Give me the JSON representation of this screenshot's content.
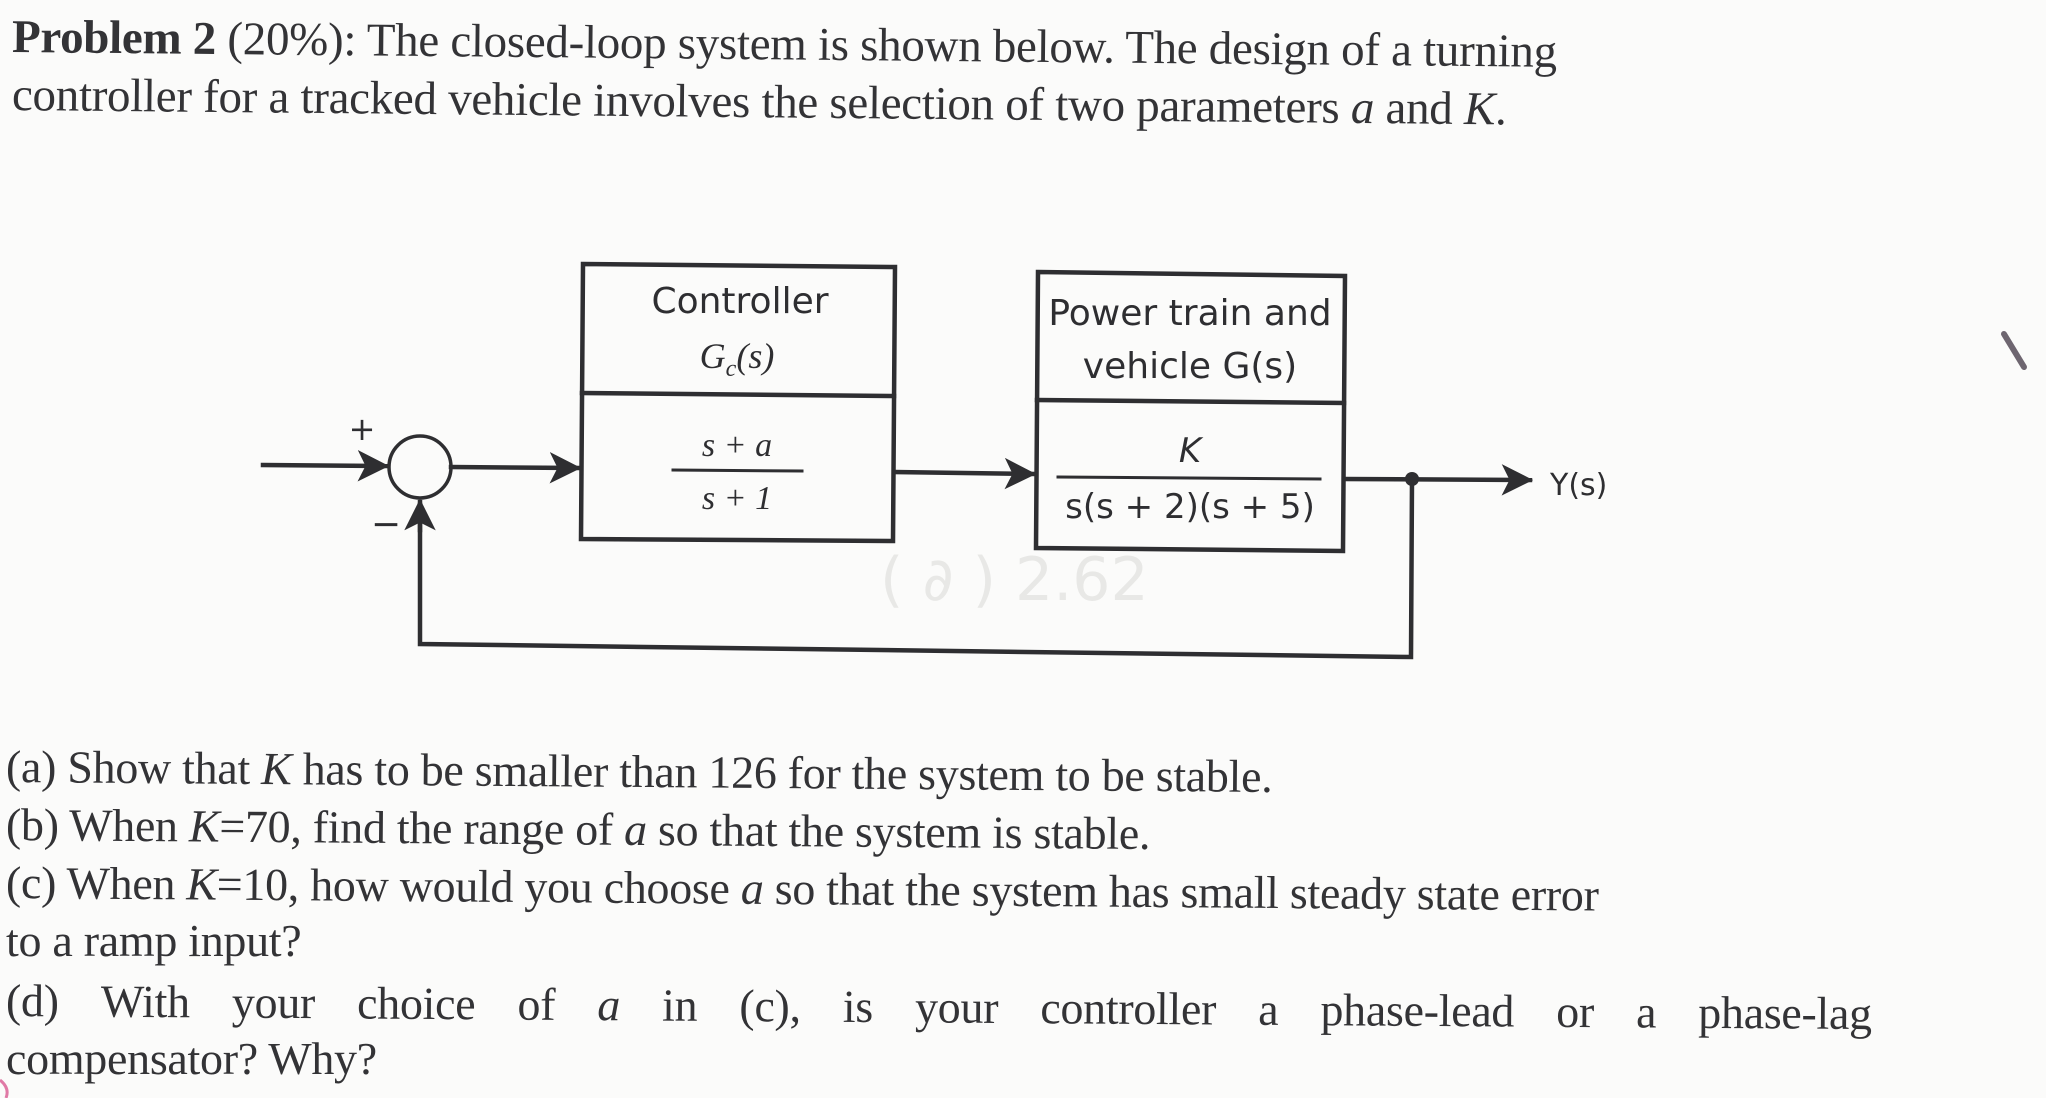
{
  "problem": {
    "heading": "Problem 2",
    "weight": "(20%):",
    "intro_line1": "The closed-loop system is shown below. The design of a turning",
    "intro_line2_a": "controller for a tracked vehicle involves the selection of two parameters ",
    "intro_var_a": "a",
    "intro_and": " and ",
    "intro_var_K": "K",
    "intro_period": "."
  },
  "diagram": {
    "summing_junction": {
      "plus_sign": "+",
      "minus_sign": "−"
    },
    "controller": {
      "label_line1": "Controller",
      "label_symbol": "G",
      "label_subscript": "c",
      "label_arg": "(s)",
      "tf_numerator": "s + a",
      "tf_denominator": "s + 1"
    },
    "plant": {
      "label_line1": "Power train and",
      "label_line2": "vehicle G(s)",
      "tf_numerator": "K",
      "tf_denominator": "s(s + 2)(s + 5)"
    },
    "output_label": "Y(s)"
  },
  "questions": [
    {
      "id": "(a)",
      "pre": " Show that ",
      "var": "K",
      "post": " has to be smaller than 126 for the system to be stable."
    },
    {
      "id": "(b)",
      "pre": " When ",
      "var": "K",
      "mid": "=70, find the range of ",
      "var2": "a",
      "post": " so that the system is stable."
    },
    {
      "id": "(c)",
      "pre": " When ",
      "var": "K",
      "mid": "=10, how would you choose ",
      "var2": "a",
      "post": " so that the system has small steady state error",
      "continuation": "to a ramp input?"
    },
    {
      "id": "(d)",
      "words": [
        "With",
        "your",
        "choice",
        "of",
        "a",
        "in",
        "(c),",
        "is",
        "your",
        "controller",
        "a",
        "phase-lead",
        "or",
        "a",
        "phase-lag"
      ],
      "continuation": "compensator? Why?"
    }
  ],
  "colors": {
    "ink": "#2e2e31",
    "paper": "#fbfbfa",
    "pen_mark": "#6e6670",
    "margin_mark": "#e07aa6"
  }
}
